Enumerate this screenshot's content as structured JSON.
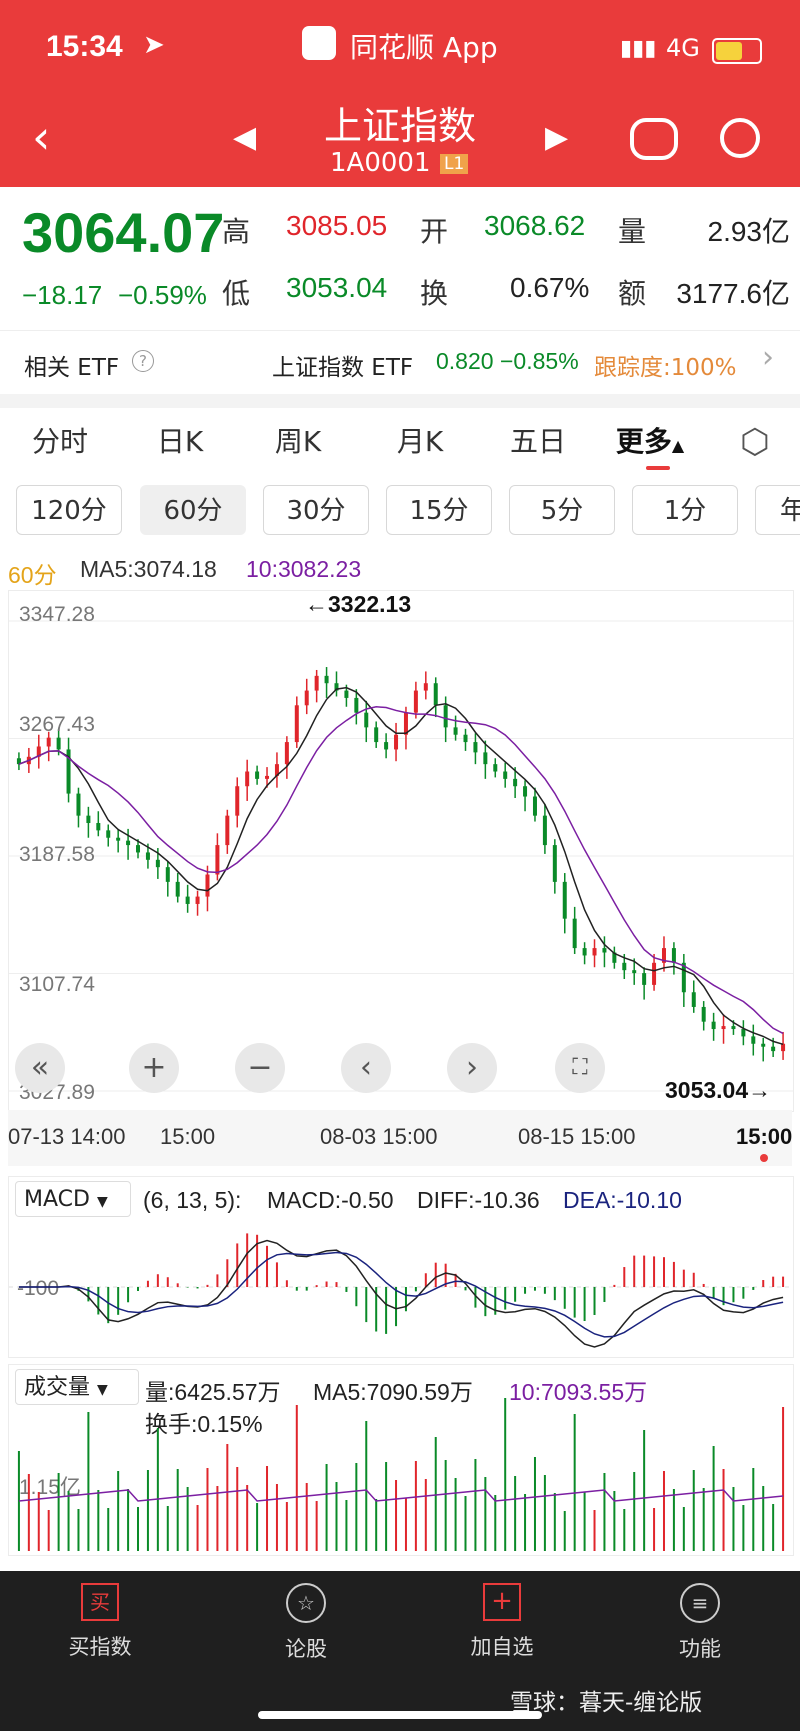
{
  "status": {
    "time": "15:34",
    "app_name": "同花顺 App",
    "network": "4G"
  },
  "header": {
    "title": "上证指数",
    "code": "1A0001",
    "level_badge": "L1"
  },
  "quote": {
    "price": "3064.07",
    "change": "−18.17",
    "change_pct": "−0.59%",
    "high_label": "高",
    "high": "3085.05",
    "open_label": "开",
    "open": "3068.62",
    "volume_label": "量",
    "volume": "2.93亿",
    "low_label": "低",
    "low": "3053.04",
    "turnover_label": "换",
    "turnover": "0.67%",
    "amount_label": "额",
    "amount": "3177.6亿"
  },
  "etf": {
    "label": "相关 ETF",
    "name": "上证指数 ETF",
    "price": "0.820",
    "change": "−0.85%",
    "tracking": "跟踪度:100%"
  },
  "tabs": [
    "分时",
    "日K",
    "周K",
    "月K",
    "五日",
    "更多"
  ],
  "periods": [
    "120分",
    "60分",
    "30分",
    "15分",
    "5分",
    "1分",
    "年"
  ],
  "chart_header": {
    "period": "60分",
    "ma5": "MA5:3074.18",
    "ma10": "10:3082.23"
  },
  "chart_data": {
    "type": "candlestick",
    "y_ticks": [
      "3347.28",
      "3267.43",
      "3187.58",
      "3107.74",
      "3027.89"
    ],
    "ylim": [
      3027.89,
      3347.28
    ],
    "x_ticks": [
      "07-13 14:00",
      "15:00",
      "08-03 15:00",
      "08-15 15:00",
      "15:00"
    ],
    "max_label": "←3322.13",
    "min_label": "3053.04→",
    "close": [
      3250,
      3255,
      3262,
      3268,
      3260,
      3230,
      3215,
      3210,
      3205,
      3200,
      3198,
      3195,
      3190,
      3185,
      3180,
      3170,
      3160,
      3155,
      3160,
      3175,
      3195,
      3215,
      3235,
      3245,
      3240,
      3242,
      3250,
      3265,
      3290,
      3300,
      3310,
      3305,
      3300,
      3295,
      3285,
      3275,
      3265,
      3260,
      3270,
      3285,
      3300,
      3305,
      3290,
      3275,
      3270,
      3265,
      3258,
      3250,
      3245,
      3240,
      3235,
      3228,
      3215,
      3195,
      3170,
      3145,
      3125,
      3120,
      3125,
      3122,
      3115,
      3110,
      3108,
      3100,
      3115,
      3125,
      3115,
      3095,
      3085,
      3075,
      3070,
      3072,
      3070,
      3065,
      3060,
      3058,
      3055,
      3060
    ],
    "ma_labels": {
      "ma5": "MA5",
      "ma10": "10"
    }
  },
  "macd": {
    "selector": "MACD",
    "params": "(6, 13, 5):",
    "macd": "MACD:-0.50",
    "diff": "DIFF:-10.36",
    "dea": "DEA:-10.10",
    "axis_label": "-100"
  },
  "volume": {
    "selector": "成交量",
    "vol": "量:6425.57万",
    "ma5": "MA5:7090.59万",
    "ma10": "10:7093.55万",
    "turnover": "换手:0.15%",
    "axis_label": "1.15亿"
  },
  "nav": [
    {
      "label": "买指数",
      "icon": "buy-icon"
    },
    {
      "label": "论股",
      "icon": "discuss-icon"
    },
    {
      "label": "加自选",
      "icon": "add-watch-icon"
    },
    {
      "label": "功能",
      "icon": "menu-icon"
    }
  ],
  "watermark": "雪球：暮天-缠论版",
  "colors": {
    "header": "#e93b3b",
    "up": "#e0252b",
    "down": "#0a8a28",
    "ma10": "#7b1fa2"
  }
}
